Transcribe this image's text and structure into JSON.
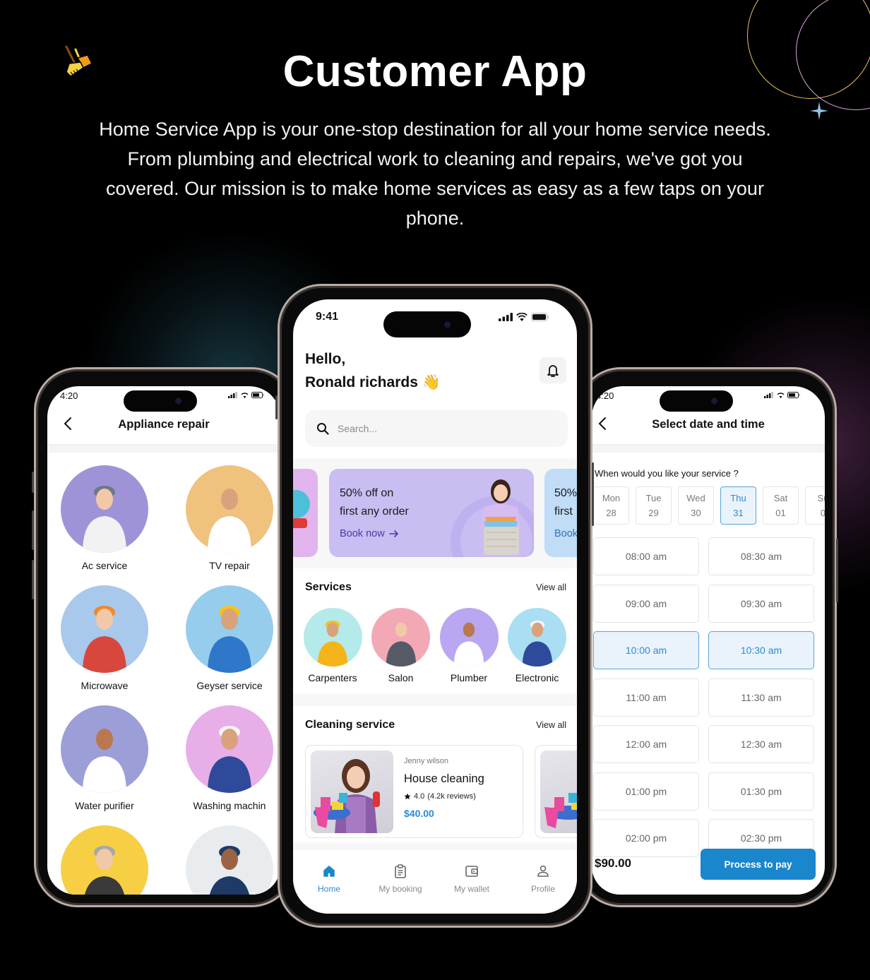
{
  "hero": {
    "title": "Customer App",
    "description": "Home Service App is your one-stop destination for all your home service needs. From plumbing and electrical work to cleaning and repairs, we've got you covered. Our mission is to make home services as easy as a few taps on your phone."
  },
  "decor": {
    "logo_icon": "broom-dustpan-icon",
    "sparkle_icon": "sparkle-icon"
  },
  "left_phone": {
    "status_time": "4:20",
    "header_title": "Appliance repair",
    "back_icon": "chevron-left-icon",
    "items": [
      {
        "label": "Ac service",
        "bg": "#9f93d8"
      },
      {
        "label": "TV repair",
        "bg": "#efc27e"
      },
      {
        "label": "Microwave",
        "bg": "#a8c8ec"
      },
      {
        "label": "Geyser service",
        "bg": "#97cdec"
      },
      {
        "label": "Water purifier",
        "bg": "#9c9ed8"
      },
      {
        "label": "Washing machin",
        "bg": "#e7aee8"
      },
      {
        "label": "",
        "bg": "#f6cf45"
      },
      {
        "label": "",
        "bg": "#e9ecef"
      }
    ]
  },
  "center_phone": {
    "status_time": "9:41",
    "greeting_line1": "Hello,",
    "greeting_line2": "Ronald richards",
    "wave_emoji": "👋",
    "notification_icon": "bell-icon",
    "search": {
      "placeholder": "Search...",
      "value": ""
    },
    "promos": [
      {
        "title_line1": "50% off on",
        "title_line2": "first any order",
        "cta": "Book now",
        "bg": "#c9bdf2"
      },
      {
        "title_line1": "50%",
        "title_line2": "first",
        "cta": "Book",
        "bg": "#c0dcf6"
      }
    ],
    "services": {
      "title": "Services",
      "view_all": "View all",
      "items": [
        {
          "label": "Carpenters",
          "bg": "#b4eaea"
        },
        {
          "label": "Salon",
          "bg": "#f3a8b6"
        },
        {
          "label": "Plumber",
          "bg": "#b9a7f1"
        },
        {
          "label": "Electronic",
          "bg": "#a9def3"
        }
      ]
    },
    "cleaning": {
      "title": "Cleaning service",
      "view_all": "View all",
      "cards": [
        {
          "provider": "Jenny wilson",
          "name": "House cleaning",
          "rating": "4.0",
          "reviews": "(4.2k reviews)",
          "price": "$40.00"
        }
      ]
    },
    "tabs": [
      {
        "label": "Home",
        "icon": "home-icon",
        "active": true
      },
      {
        "label": "My booking",
        "icon": "clipboard-icon",
        "active": false
      },
      {
        "label": "My wallet",
        "icon": "wallet-icon",
        "active": false
      },
      {
        "label": "Profile",
        "icon": "user-icon",
        "active": false
      }
    ]
  },
  "right_phone": {
    "status_time": "4:20",
    "header_title": "Select date and time",
    "question": "When would you like your service ?",
    "days": [
      {
        "day": "Mon",
        "date": "28",
        "selected": false
      },
      {
        "day": "Tue",
        "date": "29",
        "selected": false
      },
      {
        "day": "Wed",
        "date": "30",
        "selected": false
      },
      {
        "day": "Thu",
        "date": "31",
        "selected": true
      },
      {
        "day": "Sat",
        "date": "01",
        "selected": false
      },
      {
        "day": "Su",
        "date": "0",
        "selected": false
      }
    ],
    "slots": [
      {
        "time": "08:00 am",
        "selected": false
      },
      {
        "time": "08:30 am",
        "selected": false
      },
      {
        "time": "09:00 am",
        "selected": false
      },
      {
        "time": "09:30 am",
        "selected": false
      },
      {
        "time": "10:00 am",
        "selected": true
      },
      {
        "time": "10:30 am",
        "selected": true
      },
      {
        "time": "11:00 am",
        "selected": false
      },
      {
        "time": "11:30 am",
        "selected": false
      },
      {
        "time": "12:00 am",
        "selected": false
      },
      {
        "time": "12:30 am",
        "selected": false
      },
      {
        "time": "01:00 pm",
        "selected": false
      },
      {
        "time": "01:30 pm",
        "selected": false
      },
      {
        "time": "02:00 pm",
        "selected": false
      },
      {
        "time": "02:30 pm",
        "selected": false
      }
    ],
    "total": "$90.00",
    "pay_button": "Process to pay"
  },
  "colors": {
    "accent_blue": "#1a86cc",
    "price_blue": "#2a8bd6",
    "promo_link_purple": "#4b3aa8",
    "background": "#000000"
  }
}
